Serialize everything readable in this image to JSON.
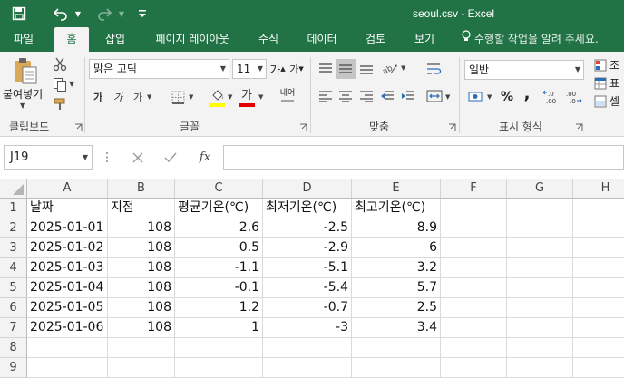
{
  "window": {
    "title": "seoul.csv - Excel"
  },
  "tabs": [
    "파일",
    "홈",
    "삽입",
    "페이지 레이아웃",
    "수식",
    "데이터",
    "검토",
    "보기"
  ],
  "tell_me": "수행할 작업을 알려 주세요.",
  "ribbon": {
    "paste_label": "붙여넣기",
    "font_name": "맑은 고딕",
    "font_size": "11",
    "number_format": "일반",
    "groups": {
      "clipboard": "클립보드",
      "font": "글꼴",
      "alignment": "맞춤",
      "number": "표시 형식"
    },
    "font_buttons": {
      "bold": "가",
      "italic": "가",
      "underline": "가",
      "grow": "가",
      "shrink": "가",
      "font_color": "가"
    },
    "wrap_label": "내어",
    "percent": "%",
    "comma": ",",
    "dec_inc": "←.0 .00",
    "dec_dec": ".00 →.0",
    "styles_partial": [
      "조",
      "표",
      "셀"
    ]
  },
  "formula_bar": {
    "name_box": "J19",
    "fx": "fx",
    "formula": ""
  },
  "columns": [
    "A",
    "B",
    "C",
    "D",
    "E",
    "F",
    "G",
    "H"
  ],
  "rows": [
    "1",
    "2",
    "3",
    "4",
    "5",
    "6",
    "7",
    "8",
    "9"
  ],
  "sheet": {
    "header": [
      "날짜",
      "지점",
      "평균기온(℃)",
      "최저기온(℃)",
      "최고기온(℃)"
    ],
    "data": [
      [
        "2025-01-01",
        "108",
        "2.6",
        "-2.5",
        "8.9"
      ],
      [
        "2025-01-02",
        "108",
        "0.5",
        "-2.9",
        "6"
      ],
      [
        "2025-01-03",
        "108",
        "-1.1",
        "-5.1",
        "3.2"
      ],
      [
        "2025-01-04",
        "108",
        "-0.1",
        "-5.4",
        "5.7"
      ],
      [
        "2025-01-05",
        "108",
        "1.2",
        "-0.7",
        "2.5"
      ],
      [
        "2025-01-06",
        "108",
        "1",
        "-3",
        "3.4"
      ]
    ]
  },
  "colors": {
    "accent": "#217346",
    "ribbon_bg": "#f3f3f3",
    "grid_line": "#dadada",
    "font_color_bar": "#e00000",
    "highlight_bar": "#ffff00"
  }
}
